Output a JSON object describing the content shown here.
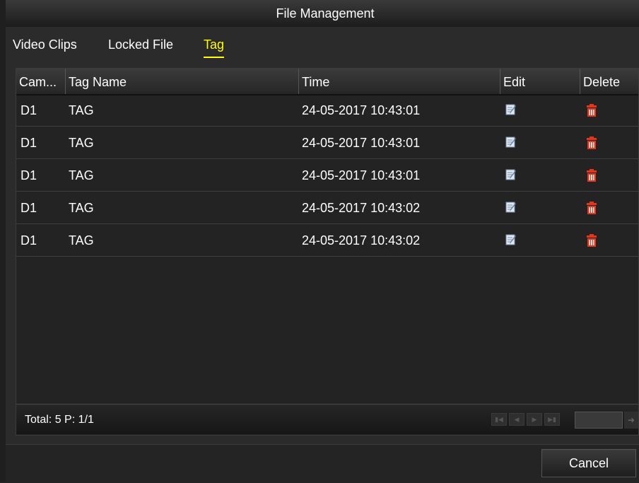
{
  "window": {
    "title": "File Management"
  },
  "tabs": [
    {
      "label": "Video Clips",
      "active": false
    },
    {
      "label": "Locked File",
      "active": false
    },
    {
      "label": "Tag",
      "active": true
    }
  ],
  "table": {
    "columns": [
      "Cam...",
      "Tag Name",
      "Time",
      "Edit",
      "Delete"
    ],
    "rows": [
      {
        "camera": "D1",
        "tag_name": "TAG",
        "time": "24-05-2017 10:43:01",
        "edit_icon": "edit-icon",
        "delete_icon": "trash-icon"
      },
      {
        "camera": "D1",
        "tag_name": "TAG",
        "time": "24-05-2017 10:43:01",
        "edit_icon": "edit-icon",
        "delete_icon": "trash-icon"
      },
      {
        "camera": "D1",
        "tag_name": "TAG",
        "time": "24-05-2017 10:43:01",
        "edit_icon": "edit-icon",
        "delete_icon": "trash-icon"
      },
      {
        "camera": "D1",
        "tag_name": "TAG",
        "time": "24-05-2017 10:43:02",
        "edit_icon": "edit-icon",
        "delete_icon": "trash-icon"
      },
      {
        "camera": "D1",
        "tag_name": "TAG",
        "time": "24-05-2017 10:43:02",
        "edit_icon": "edit-icon",
        "delete_icon": "trash-icon"
      }
    ]
  },
  "footer": {
    "total_text": "Total: 5 P: 1/1",
    "pager_icons": [
      "first-page-icon",
      "prev-page-icon",
      "next-page-icon",
      "last-page-icon",
      "go-icon"
    ],
    "page_input_value": ""
  },
  "buttons": {
    "cancel": "Cancel"
  },
  "colors": {
    "active_tab": "#ffff00",
    "delete_icon": "#e0381c",
    "background": "#2b2b2b"
  }
}
